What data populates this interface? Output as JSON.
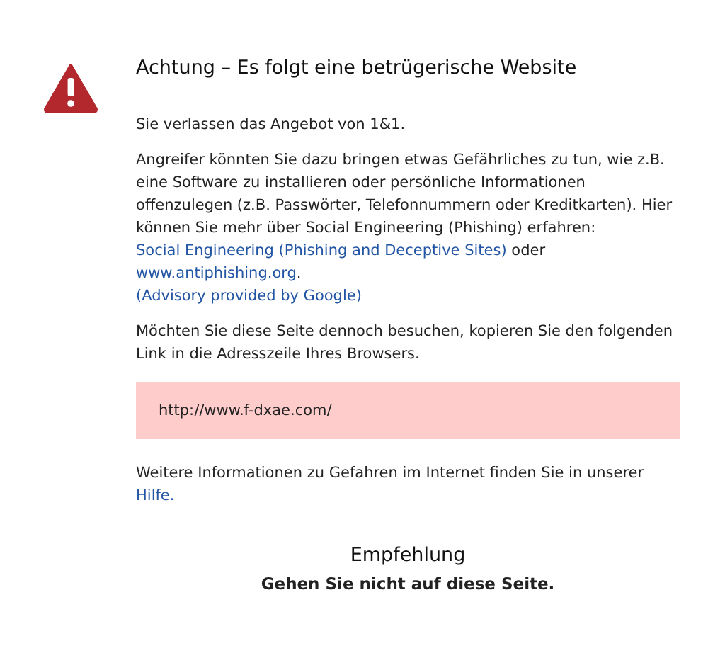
{
  "title": "Achtung – Es folgt eine betrügerische Website",
  "intro": "Sie verlassen das Angebot von 1&1.",
  "warning": [
    {
      "kind": "text",
      "text": "Angreifer könnten Sie dazu bringen etwas Gefährliches zu tun, wie z.B. eine Software zu installieren oder persönliche Informationen offenzulegen (z.B. Passwörter, Telefonnummern oder Kreditkarten). Hier können Sie mehr über Social Engineering (Phishing) erfahren:"
    },
    {
      "kind": "link",
      "text": "Social Engineering (Phishing and Deceptive Sites)"
    },
    {
      "kind": "text",
      "text": "oder"
    },
    {
      "kind": "link",
      "text": "www.antiphishing.org"
    },
    {
      "kind": "text",
      "text": "."
    },
    {
      "kind": "break"
    },
    {
      "kind": "link",
      "text": "(Advisory provided by Google)"
    }
  ],
  "instruction": "Möchten Sie diese Seite dennoch besuchen, kopieren Sie den folgenden Link in die Adresszeile Ihres Browsers.",
  "url": "http://www.f-dxae.com/",
  "more_info": [
    {
      "kind": "text",
      "text": "Weitere Informationen zu Gefahren im Internet finden Sie in unserer"
    },
    {
      "kind": "link",
      "text": "Hilfe."
    }
  ],
  "recommendation": {
    "heading": "Empfehlung",
    "text": "Gehen Sie nicht auf diese Seite."
  }
}
